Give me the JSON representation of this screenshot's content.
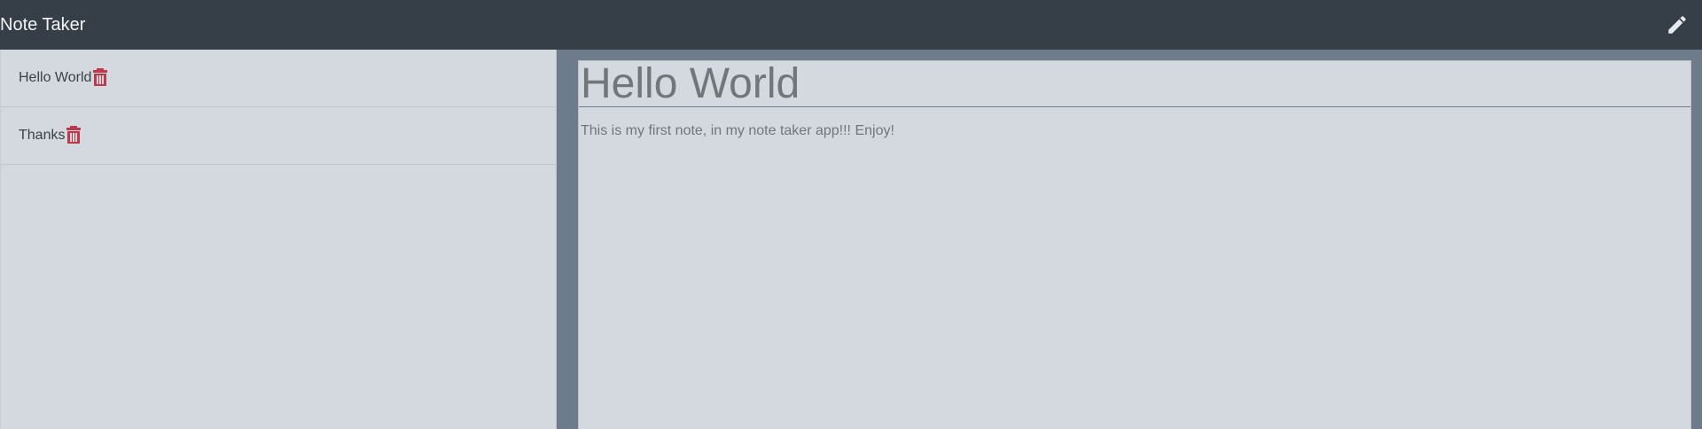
{
  "navbar": {
    "brand": "Note Taker",
    "new_note_icon": "pencil-icon"
  },
  "notes": [
    {
      "title": "Hello World",
      "delete_icon": "trash-icon"
    },
    {
      "title": "Thanks",
      "delete_icon": "trash-icon"
    }
  ],
  "active_note": {
    "title": "Hello World",
    "text": "This is my first note, in my note taker app!!! Enjoy!"
  },
  "colors": {
    "navbar": "#363f48",
    "sidebar": "#d3d9de",
    "main_bg": "#6e7b8a",
    "delete": "#c0394a",
    "pencil": "#e8ebee"
  }
}
